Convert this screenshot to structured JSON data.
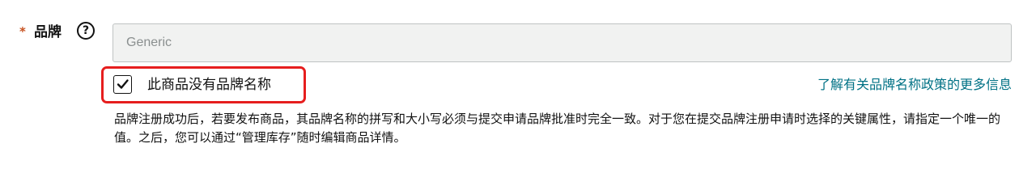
{
  "brand_field": {
    "required_marker": "*",
    "label": "品牌",
    "help_icon": "question-circle-icon",
    "input_placeholder": "Generic",
    "input_value": ""
  },
  "no_brand": {
    "checked": true,
    "checkbox_icon": "checkmark-icon",
    "label": "此商品没有品牌名称",
    "policy_link": "了解有关品牌名称政策的更多信息"
  },
  "help_text": "品牌注册成功后，若要发布商品，其品牌名称的拼写和大小写必须与提交申请品牌批准时完全一致。对于您在提交品牌注册申请时选择的关键属性，请指定一个唯一的值。之后，您可以通过“管理库存”随时编辑商品详情。",
  "colors": {
    "required": "#c7511f",
    "link": "#007185",
    "highlight": "#e61e1e",
    "input_background": "#f1f2f1"
  }
}
